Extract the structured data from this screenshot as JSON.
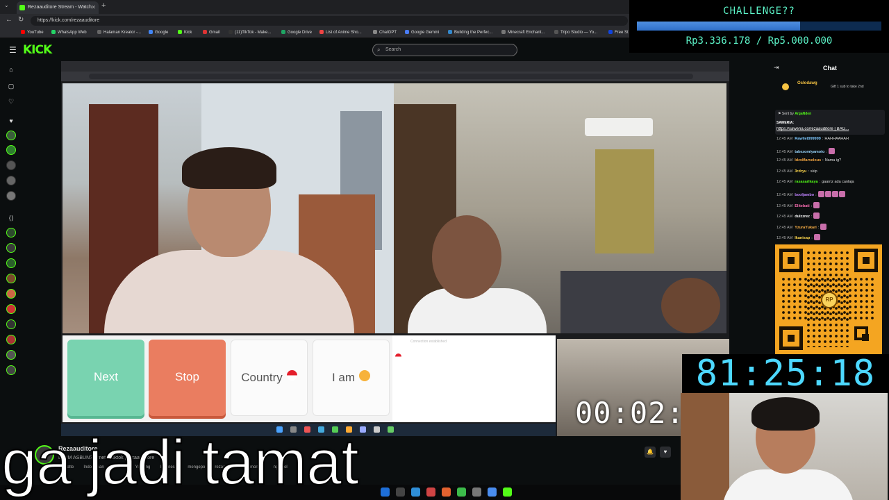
{
  "browser": {
    "tab_title": "Rezaauditore Stream - Watch",
    "url": "https://kick.com/rezaauditore",
    "bookmarks": [
      "YouTube",
      "WhatsApp Web",
      "Halaman Kreator -...",
      "Google",
      "Kick",
      "Gmail",
      "(11)TikTok - Make...",
      "Google Drive",
      "List of Anime Sho...",
      "ChatGPT",
      "Google Gemini",
      "Building the Perfec...",
      "Minecraft Enchant...",
      "Tripo Studio — Yo...",
      "Free St"
    ]
  },
  "kick": {
    "logo": "KICK",
    "search_placeholder": "Search"
  },
  "challenge": {
    "title": "CHALLENGE??",
    "amount_text": "Rp3.336.178 / Rp5.000.000",
    "progress_fraction": 0.667
  },
  "stream": {
    "controls": {
      "next_label": "Next",
      "stop_label": "Stop",
      "country_label": "Country",
      "iam_label": "I am"
    },
    "chat_notice": "Connection established",
    "timer_small": "00:02:",
    "timer_big": "81:25:18"
  },
  "chat": {
    "title": "Chat",
    "sub_user": "Oslodawg",
    "sub_gift": "Gift 1 sub to take 2nd",
    "sent_by_label": "Sent by",
    "sent_by_user": "ArgaNden",
    "sent_title": "SAWERIA:",
    "sent_link": "https://saweria.co/rezaauditore | BAG...",
    "messages": [
      {
        "time": "12:45 AM",
        "user": "Rawliet999999",
        "text": "HAHHAAHAH",
        "color": "#7ec8ff"
      },
      {
        "time": "12:45 AM",
        "user": "takezomiyamoto",
        "text": "",
        "color": "#9ad7ff"
      },
      {
        "time": "12:45 AM",
        "user": "IdzxMarvelous",
        "text": "Nama ig?",
        "color": "#f5a742"
      },
      {
        "time": "12:45 AM",
        "user": "3rdryu",
        "text": "skip",
        "color": "#ffd84d"
      },
      {
        "time": "12:45 AM",
        "user": "rasasarikaya",
        "text": "gaarriz ada canlaja",
        "color": "#53fc18"
      },
      {
        "time": "12:45 AM",
        "user": "booljambo",
        "text": "",
        "color": "#c083ff"
      },
      {
        "time": "12:45 AM",
        "user": "Elitebati",
        "text": "",
        "color": "#ff6eb4"
      },
      {
        "time": "12:45 AM",
        "user": "dulzzrez",
        "text": "",
        "color": "#ffffff"
      },
      {
        "time": "12:45 AM",
        "user": "YzuraYukari",
        "text": "",
        "color": "#ffb347"
      },
      {
        "time": "12:45 AM",
        "user": "Ikanisap",
        "text": "",
        "color": "#ffd84d"
      }
    ]
  },
  "channel": {
    "name": "Rezaauditore",
    "title": "DIKIM ASBUN? Ometv | tiktok | rezaauditore",
    "tags": [
      "Roulette",
      "Indonesian",
      "Horror",
      "Yapping",
      "Indonesia",
      "mengepo",
      "rezaauditore",
      "omomov",
      "ngobrol"
    ]
  },
  "caption": "ga jadi tamat",
  "qr_badge": "RP"
}
